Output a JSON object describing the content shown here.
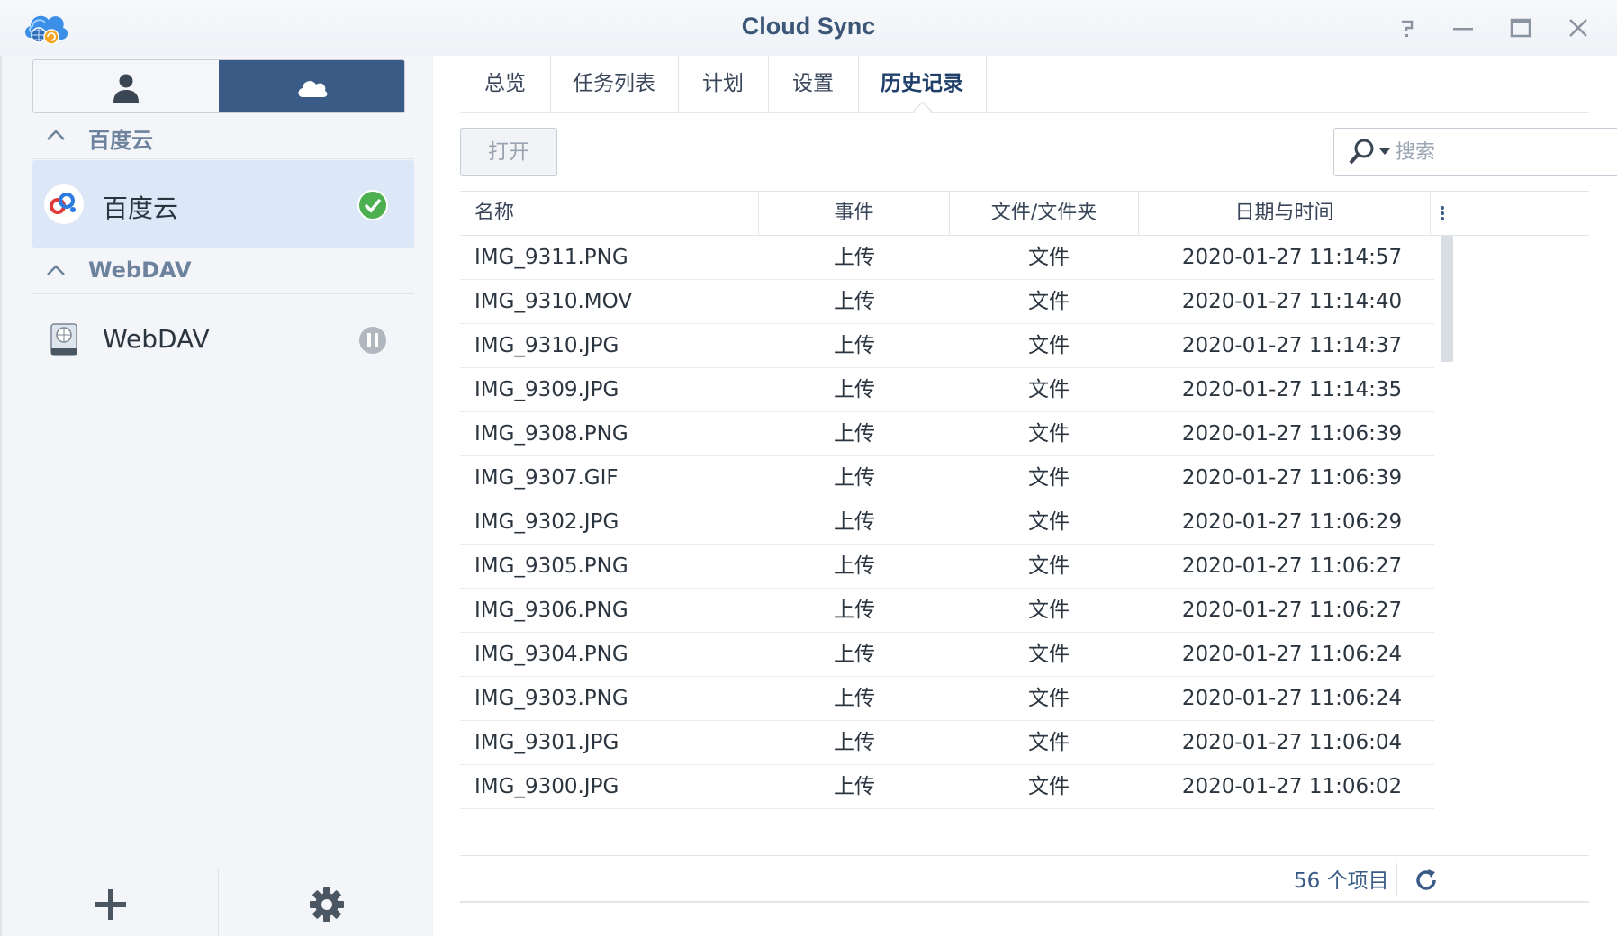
{
  "window": {
    "title": "Cloud Sync"
  },
  "sidebar": {
    "groups": [
      {
        "title": "百度云",
        "accounts": [
          {
            "name": "百度云",
            "status": "synced"
          }
        ]
      },
      {
        "title": "WebDAV",
        "accounts": [
          {
            "name": "WebDAV",
            "status": "paused"
          }
        ]
      }
    ]
  },
  "tabs": [
    {
      "label": "总览"
    },
    {
      "label": "任务列表"
    },
    {
      "label": "计划"
    },
    {
      "label": "设置"
    },
    {
      "label": "历史记录",
      "active": true
    }
  ],
  "toolbar": {
    "open_label": "打开",
    "search_placeholder": "搜索"
  },
  "table": {
    "columns": [
      "名称",
      "事件",
      "文件/文件夹",
      "日期与时间"
    ],
    "rows": [
      {
        "name": "IMG_9311.PNG",
        "event": "上传",
        "type": "文件",
        "datetime": "2020-01-27 11:14:57"
      },
      {
        "name": "IMG_9310.MOV",
        "event": "上传",
        "type": "文件",
        "datetime": "2020-01-27 11:14:40"
      },
      {
        "name": "IMG_9310.JPG",
        "event": "上传",
        "type": "文件",
        "datetime": "2020-01-27 11:14:37"
      },
      {
        "name": "IMG_9309.JPG",
        "event": "上传",
        "type": "文件",
        "datetime": "2020-01-27 11:14:35"
      },
      {
        "name": "IMG_9308.PNG",
        "event": "上传",
        "type": "文件",
        "datetime": "2020-01-27 11:06:39"
      },
      {
        "name": "IMG_9307.GIF",
        "event": "上传",
        "type": "文件",
        "datetime": "2020-01-27 11:06:39"
      },
      {
        "name": "IMG_9302.JPG",
        "event": "上传",
        "type": "文件",
        "datetime": "2020-01-27 11:06:29"
      },
      {
        "name": "IMG_9305.PNG",
        "event": "上传",
        "type": "文件",
        "datetime": "2020-01-27 11:06:27"
      },
      {
        "name": "IMG_9306.PNG",
        "event": "上传",
        "type": "文件",
        "datetime": "2020-01-27 11:06:27"
      },
      {
        "name": "IMG_9304.PNG",
        "event": "上传",
        "type": "文件",
        "datetime": "2020-01-27 11:06:24"
      },
      {
        "name": "IMG_9303.PNG",
        "event": "上传",
        "type": "文件",
        "datetime": "2020-01-27 11:06:24"
      },
      {
        "name": "IMG_9301.JPG",
        "event": "上传",
        "type": "文件",
        "datetime": "2020-01-27 11:06:04"
      },
      {
        "name": "IMG_9300.JPG",
        "event": "上传",
        "type": "文件",
        "datetime": "2020-01-27 11:06:02"
      }
    ]
  },
  "footer": {
    "item_count": "56 个项目"
  },
  "colors": {
    "accent": "#3a5b86",
    "title": "#3c5677",
    "selected": "#dce8f7",
    "success": "#4caf50"
  }
}
